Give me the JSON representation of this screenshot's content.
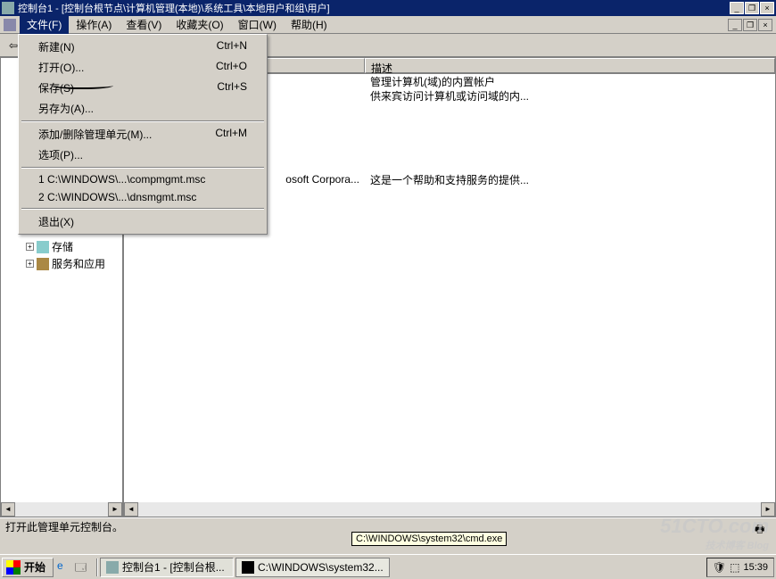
{
  "window": {
    "title": "控制台1 - [控制台根节点\\计算机管理(本地)\\系统工具\\本地用户和组\\用户]"
  },
  "menubar": {
    "items": [
      {
        "label": "文件(F)"
      },
      {
        "label": "操作(A)"
      },
      {
        "label": "查看(V)"
      },
      {
        "label": "收藏夹(O)"
      },
      {
        "label": "窗口(W)"
      },
      {
        "label": "帮助(H)"
      }
    ]
  },
  "file_menu": {
    "items": [
      {
        "label": "新建(N)",
        "shortcut": "Ctrl+N"
      },
      {
        "label": "打开(O)...",
        "shortcut": "Ctrl+O"
      },
      {
        "label": "保存(S)",
        "shortcut": "Ctrl+S"
      },
      {
        "label": "另存为(A)...",
        "shortcut": ""
      }
    ],
    "section2": [
      {
        "label": "添加/删除管理单元(M)...",
        "shortcut": "Ctrl+M"
      },
      {
        "label": "选项(P)...",
        "shortcut": ""
      }
    ],
    "recent": [
      {
        "label": "1 C:\\WINDOWS\\...\\compmgmt.msc"
      },
      {
        "label": "2 C:\\WINDOWS\\...\\dnsmgmt.msc"
      }
    ],
    "exit": {
      "label": "退出(X)"
    }
  },
  "tree": {
    "node_storage": "存储",
    "node_services": "服务和应用"
  },
  "list": {
    "col_desc": "描述",
    "rows": [
      {
        "cell_partial": "",
        "desc": "管理计算机(域)的内置帐户"
      },
      {
        "cell_partial": "",
        "desc": "供来宾访问计算机或访问域的内..."
      },
      {
        "cell_partial": "osoft Corpora...",
        "desc": "这是一个帮助和支持服务的提供..."
      }
    ]
  },
  "statusbar": {
    "text": "打开此管理单元控制台。"
  },
  "tooltip": {
    "text": "C:\\WINDOWS\\system32\\cmd.exe"
  },
  "taskbar": {
    "start": "开始",
    "tasks": [
      {
        "label": "控制台1 - [控制台根..."
      },
      {
        "label": "C:\\WINDOWS\\system32..."
      }
    ],
    "clock": "15:39"
  },
  "watermark": {
    "main": "51CTO.com",
    "sub": "技术博客 Blog"
  }
}
